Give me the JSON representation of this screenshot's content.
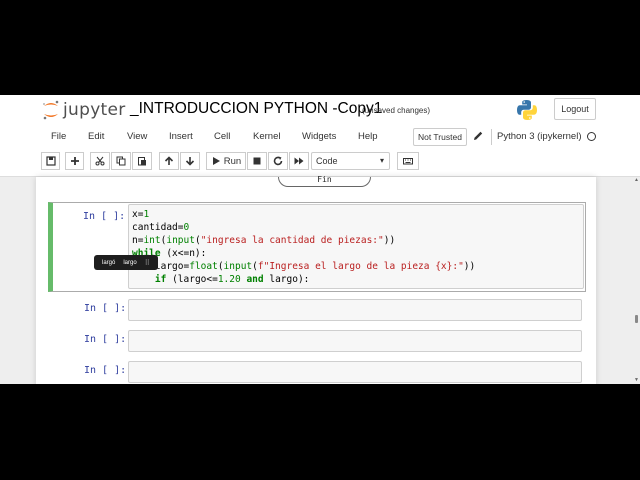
{
  "header": {
    "logo_text": "jupyter",
    "notebook_title": "_INTRODUCCION PYTHON -Copy1",
    "save_status": "(unsaved changes)",
    "logout_label": "Logout"
  },
  "menubar": {
    "items": [
      "File",
      "Edit",
      "View",
      "Insert",
      "Cell",
      "Kernel",
      "Widgets",
      "Help"
    ],
    "trust_label": "Not Trusted",
    "kernel_name": "Python 3 (ipykernel)"
  },
  "toolbar": {
    "run_label": "Run",
    "cell_type": "Code",
    "icons": [
      "save-icon",
      "plus-icon",
      "cut-icon",
      "copy-icon",
      "paste-icon",
      "arrow-up-icon",
      "arrow-down-icon",
      "play-icon",
      "stop-icon",
      "restart-icon",
      "fast-forward-icon",
      "keyboard-icon"
    ]
  },
  "previous_output": {
    "label": "Fin"
  },
  "cells": [
    {
      "prompt": "In [ ]:",
      "lines": [
        "x=1",
        "cantidad=0",
        "n=int(input(\"ingresa la cantidad de piezas:\"))",
        "while (x<=n):",
        "    largo=float(input(f\"Ingresa el largo de la pieza {x}:\"))",
        "    if (largo<=1.20 and largo):"
      ]
    },
    {
      "prompt": "In [ ]:"
    },
    {
      "prompt": "In [ ]:"
    },
    {
      "prompt": "In [ ]:"
    }
  ],
  "tooltip": {
    "items": [
      "largó",
      "largo"
    ]
  },
  "colors": {
    "selected_cell_border": "#66bb6a",
    "prompt_color": "#303f9f",
    "keyword_color": "#008000",
    "string_color": "#ba2121",
    "jupyter_orange": "#f37726"
  }
}
